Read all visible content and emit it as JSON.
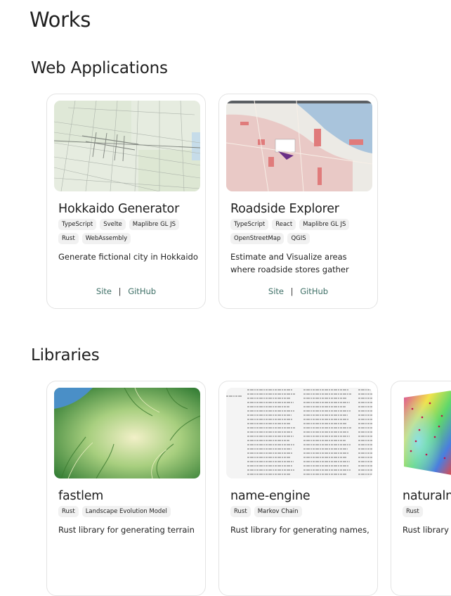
{
  "page": {
    "title": "Works"
  },
  "sections": [
    {
      "title": "Web Applications",
      "cards": [
        {
          "title": "Hokkaido Generator",
          "tags": [
            "TypeScript",
            "Svelte",
            "Maplibre GL JS",
            "Rust",
            "WebAssembly"
          ],
          "description": "Generate fictional city in Hokkaido",
          "links": {
            "site": "Site",
            "separator": "|",
            "github": "GitHub"
          }
        },
        {
          "title": "Roadside Explorer",
          "tags": [
            "TypeScript",
            "React",
            "Maplibre GL JS",
            "OpenStreetMap",
            "QGIS"
          ],
          "description": "Estimate and Visualize areas where roadside stores gather",
          "links": {
            "site": "Site",
            "separator": "|",
            "github": "GitHub"
          }
        }
      ]
    },
    {
      "title": "Libraries",
      "cards": [
        {
          "title": "fastlem",
          "tags": [
            "Rust",
            "Landscape Evolution Model"
          ],
          "description": "Rust library for generating terrain"
        },
        {
          "title": "name-engine",
          "tags": [
            "Rust",
            "Markov Chain"
          ],
          "description": "Rust library for generating names,"
        },
        {
          "title": "naturalneighbor",
          "tags": [
            "Rust"
          ],
          "description": "Rust library for natural neighbor interpolation"
        }
      ]
    }
  ]
}
